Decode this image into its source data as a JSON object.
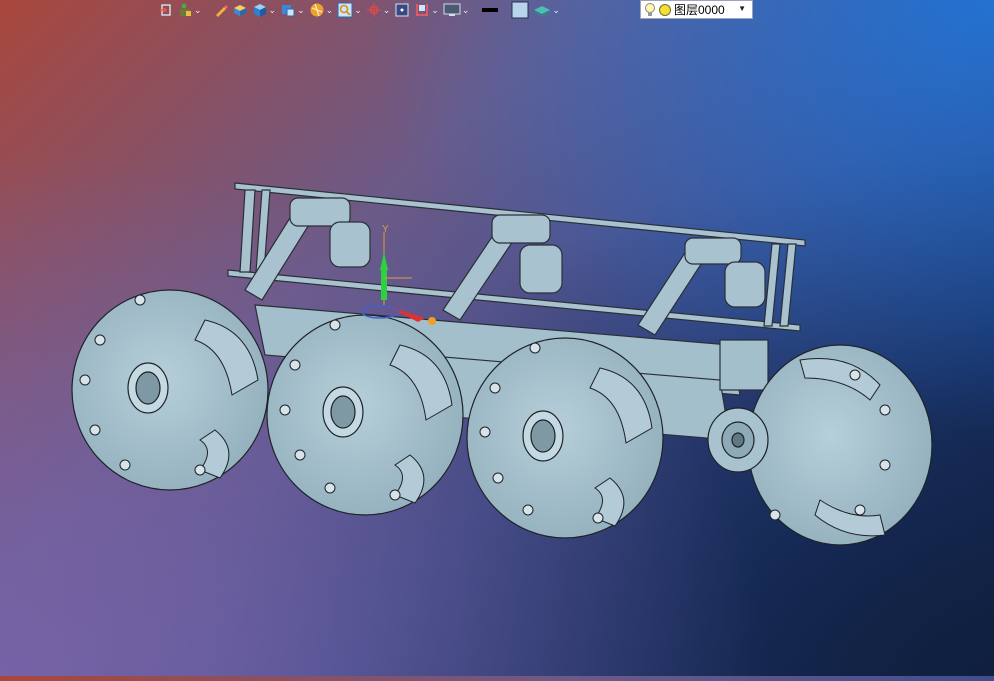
{
  "toolbar": {
    "buttons": [
      {
        "name": "import-icon"
      },
      {
        "name": "paint-figure-icon"
      },
      {
        "name": "pencil-icon"
      },
      {
        "name": "box-solid-icon"
      },
      {
        "name": "cube-icon"
      },
      {
        "name": "view-cube-icon"
      },
      {
        "name": "render-ball-icon"
      },
      {
        "name": "zoom-icon"
      },
      {
        "name": "snap-point-icon"
      },
      {
        "name": "frame-icon"
      },
      {
        "name": "dimension-icon"
      },
      {
        "name": "display-monitor-icon"
      },
      {
        "name": "line-color-swatch"
      },
      {
        "name": "fill-color-swatch"
      },
      {
        "name": "layer-stack-icon"
      }
    ],
    "layer": {
      "name": "图层0000"
    }
  },
  "viewport": {
    "axis_label": "Y",
    "model_color": "#a8c3cf"
  }
}
